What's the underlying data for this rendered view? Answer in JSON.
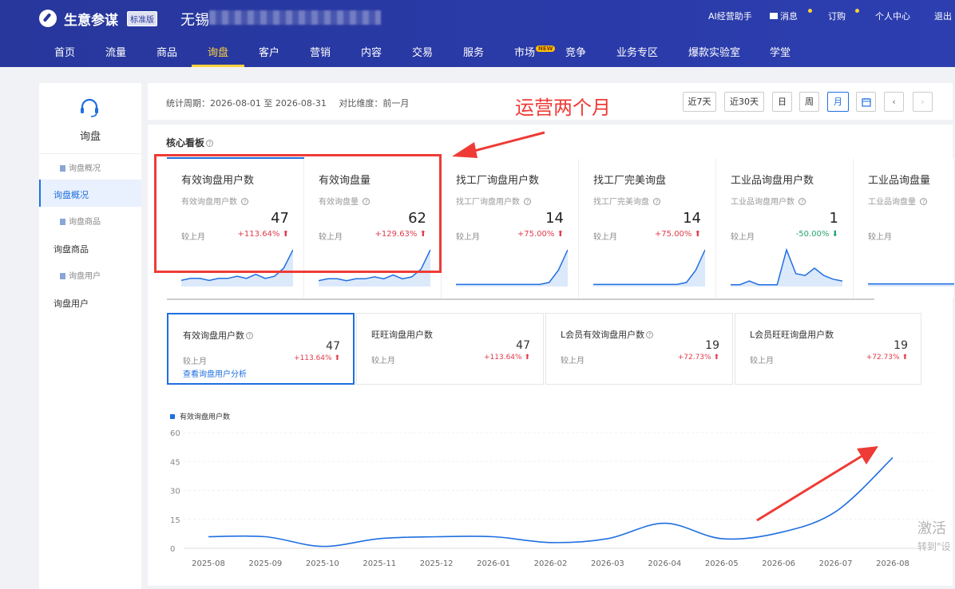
{
  "header": {
    "logo": "生意参谋",
    "edition": "标准版",
    "shop_name": "无锡",
    "top_links": [
      "AI经营助手",
      "消息",
      "订购",
      "个人中心",
      "退出"
    ]
  },
  "nav": {
    "items": [
      "首页",
      "流量",
      "商品",
      "询盘",
      "客户",
      "营销",
      "内容",
      "交易",
      "服务",
      "市场",
      "竞争",
      "业务专区",
      "爆款实验室",
      "学堂"
    ],
    "active": "询盘",
    "new_badge": "NEW"
  },
  "sidebar": {
    "title": "询盘",
    "items": [
      {
        "label": "询盘概况",
        "level": "sub"
      },
      {
        "label": "询盘概况",
        "level": "main",
        "active": true
      },
      {
        "label": "询盘商品",
        "level": "sub"
      },
      {
        "label": "询盘商品",
        "level": "main"
      },
      {
        "label": "询盘用户",
        "level": "sub"
      },
      {
        "label": "询盘用户",
        "level": "main"
      }
    ]
  },
  "filter": {
    "period_label": "统计周期：",
    "period_value": "2026-08-01 至 2026-08-31",
    "compare_label": "对比维度：",
    "compare_value": "前一月",
    "buttons": [
      "近7天",
      "近30天",
      "日",
      "周",
      "月"
    ],
    "selected": "月"
  },
  "annotation": {
    "top_text": "运营两个月"
  },
  "board": {
    "title": "核心看板",
    "cards": [
      {
        "title": "有效询盘用户数",
        "sub": "有效询盘用户数",
        "value": "47",
        "label": "较上月",
        "change": "+113.64%",
        "dir": "up",
        "spark": [
          3,
          4,
          4,
          3,
          4,
          4,
          5,
          4,
          6,
          4,
          5,
          9,
          18
        ]
      },
      {
        "title": "有效询盘量",
        "sub": "有效询盘量",
        "value": "62",
        "label": "较上月",
        "change": "+129.63%",
        "dir": "up",
        "spark": [
          3,
          4,
          4,
          3,
          4,
          4,
          5,
          4,
          6,
          4,
          5,
          9,
          19
        ]
      },
      {
        "title": "找工厂询盘用户数",
        "sub": "找工厂询盘用户数",
        "value": "14",
        "label": "较上月",
        "change": "+75.00%",
        "dir": "up",
        "spark": [
          1,
          1,
          1,
          1,
          1,
          1,
          1,
          1,
          1,
          1,
          2,
          8,
          18
        ]
      },
      {
        "title": "找工厂完美询盘",
        "sub": "找工厂完美询盘",
        "value": "14",
        "label": "较上月",
        "change": "+75.00%",
        "dir": "up",
        "spark": [
          1,
          1,
          1,
          1,
          1,
          1,
          1,
          1,
          1,
          1,
          2,
          8,
          18
        ]
      },
      {
        "title": "工业品询盘用户数",
        "sub": "工业品询盘用户数",
        "value": "1",
        "label": "较上月",
        "change": "-50.00%",
        "dir": "down",
        "spark": [
          1,
          1,
          3,
          1,
          1,
          1,
          20,
          7,
          6,
          10,
          6,
          4,
          3
        ]
      },
      {
        "title": "工业品询盘量",
        "sub": "工业品询盘量",
        "value": "",
        "label": "较上月",
        "change": "",
        "dir": "up",
        "spark": [
          1,
          1,
          1,
          1,
          1,
          1,
          1,
          1,
          1,
          1,
          1,
          2,
          14
        ]
      }
    ],
    "sub_cards": [
      {
        "title": "有效询盘用户数",
        "value": "47",
        "label": "较上月",
        "change": "+113.64%",
        "link": "查看询盘用户分析"
      },
      {
        "title": "旺旺询盘用户数",
        "value": "47",
        "label": "较上月",
        "change": "+113.64%"
      },
      {
        "title": "L会员有效询盘用户数",
        "value": "19",
        "label": "较上月",
        "change": "+72.73%"
      },
      {
        "title": "L会员旺旺询盘用户数",
        "value": "19",
        "label": "较上月",
        "change": "+72.73%"
      }
    ]
  },
  "chart_data": {
    "type": "line",
    "series": [
      {
        "name": "有效询盘用户数",
        "values": [
          6,
          6,
          1,
          5,
          6,
          6,
          3,
          5,
          13,
          5,
          8,
          19,
          47
        ]
      }
    ],
    "x": [
      "2025-08",
      "2025-09",
      "2025-10",
      "2025-11",
      "2025-12",
      "2026-01",
      "2026-02",
      "2026-03",
      "2026-04",
      "2026-05",
      "2026-06",
      "2026-07",
      "2026-08"
    ],
    "yticks": [
      0,
      15,
      30,
      45,
      60
    ],
    "ylim": [
      0,
      60
    ],
    "color": "#1f6fe0"
  },
  "watermark": {
    "line1": "激活",
    "line2": "转到\"设"
  }
}
